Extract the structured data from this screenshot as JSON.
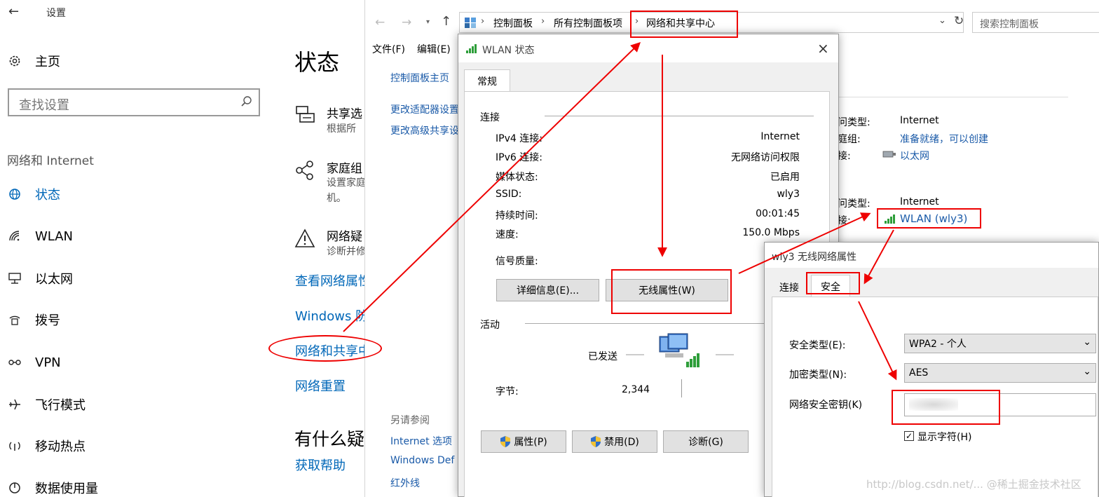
{
  "settings": {
    "back_label": "设置",
    "home": "主页",
    "search_placeholder": "查找设置",
    "section": "网络和 Internet",
    "nav": [
      {
        "label": "状态",
        "icon": "globe-icon"
      },
      {
        "label": "WLAN",
        "icon": "wifi-icon"
      },
      {
        "label": "以太网",
        "icon": "ethernet-icon"
      },
      {
        "label": "拨号",
        "icon": "dialup-icon"
      },
      {
        "label": "VPN",
        "icon": "vpn-icon"
      },
      {
        "label": "飞行模式",
        "icon": "airplane-icon"
      },
      {
        "label": "移动热点",
        "icon": "hotspot-icon"
      },
      {
        "label": "数据使用量",
        "icon": "data-usage-icon"
      }
    ],
    "page_title": "状态",
    "items": [
      {
        "title": "共享选",
        "sub": "根据所"
      },
      {
        "title": "家庭组",
        "sub": "设置家庭",
        "sub2": "机。"
      },
      {
        "title": "网络疑",
        "sub": "诊断并修"
      }
    ],
    "links": [
      "查看网络属性",
      "Windows 防",
      "网络和共享中",
      "网络重置"
    ],
    "help_title": "有什么疑",
    "help_link": "获取帮助"
  },
  "control_panel": {
    "breadcrumb": [
      "控制面板",
      "所有控制面板项",
      "网络和共享中心"
    ],
    "search_placeholder": "搜索控制面板",
    "menu": [
      "文件(F)",
      "编辑(E)"
    ],
    "sidebar_links": [
      "控制面板主页",
      "更改适配器设置",
      "更改高级共享设"
    ],
    "see_also_title": "另请参阅",
    "see_also": [
      "Internet 选项",
      "Windows Def",
      "红外线"
    ],
    "net1": [
      {
        "label": "访问类型:",
        "value": "Internet"
      },
      {
        "label": "家庭组:",
        "value": "准备就绪，可以创建"
      },
      {
        "label": "连接:",
        "value": "以太网"
      }
    ],
    "net2": [
      {
        "label": "访问类型:",
        "value": "Internet"
      },
      {
        "label": "连接:",
        "value": "WLAN (wly3)"
      }
    ]
  },
  "wlan_status": {
    "title": "WLAN 状态",
    "tab": "常规",
    "connection_header": "连接",
    "rows": [
      {
        "label": "IPv4 连接:",
        "value": "Internet"
      },
      {
        "label": "IPv6 连接:",
        "value": "无网络访问权限"
      },
      {
        "label": "媒体状态:",
        "value": "已启用"
      },
      {
        "label": "SSID:",
        "value": "wly3"
      },
      {
        "label": "持续时间:",
        "value": "00:01:45"
      },
      {
        "label": "速度:",
        "value": "150.0 Mbps"
      }
    ],
    "signal_label": "信号质量:",
    "details_button": "详细信息(E)...",
    "wireless_props_button": "无线属性(W)",
    "activity_header": "活动",
    "sent_label": "已发送",
    "bytes_label": "字节:",
    "bytes_sent": "2,344",
    "buttons": [
      "属性(P)",
      "禁用(D)",
      "诊断(G)"
    ]
  },
  "wireless_props": {
    "title": "wly3 无线网络属性",
    "tabs": [
      "连接",
      "安全"
    ],
    "security_type_label": "安全类型(E):",
    "security_type_value": "WPA2 - 个人",
    "encryption_label": "加密类型(N):",
    "encryption_value": "AES",
    "key_label": "网络安全密钥(K)",
    "show_chars_label": "显示字符(H)"
  },
  "watermark": "http://blog.csdn.net/...  @稀土掘金技术社区",
  "colors": {
    "accent": "#0067b8",
    "annotation": "#e00000",
    "dialog_bg": "#f0f0f0"
  }
}
